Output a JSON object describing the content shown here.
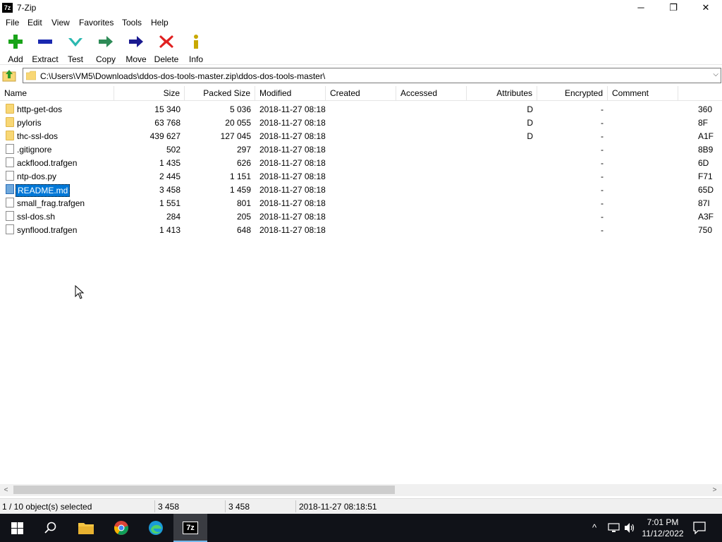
{
  "window": {
    "title": "7-Zip",
    "icon_text": "7z",
    "controls": {
      "minimize": "─",
      "maximize": "❐",
      "close": "✕"
    }
  },
  "menu": [
    "File",
    "Edit",
    "View",
    "Favorites",
    "Tools",
    "Help"
  ],
  "toolbar": {
    "add": "Add",
    "extract": "Extract",
    "test": "Test",
    "copy": "Copy",
    "move": "Move",
    "delete": "Delete",
    "info": "Info"
  },
  "address": {
    "path": "C:\\Users\\VM5\\Downloads\\ddos-dos-tools-master.zip\\ddos-dos-tools-master\\",
    "dropdown_glyph": "⌵"
  },
  "columns": [
    "Name",
    "Size",
    "Packed Size",
    "Modified",
    "Created",
    "Accessed",
    "Attributes",
    "Encrypted",
    "Comment"
  ],
  "files": [
    {
      "name": "http-get-dos",
      "type": "folder",
      "size": "15 340",
      "packed": "5 036",
      "modified": "2018-11-27 08:18",
      "attributes": "D",
      "encrypted": "-",
      "crc": "360",
      "selected": false
    },
    {
      "name": "pyloris",
      "type": "folder",
      "size": "63 768",
      "packed": "20 055",
      "modified": "2018-11-27 08:18",
      "attributes": "D",
      "encrypted": "-",
      "crc": "8F",
      "selected": false
    },
    {
      "name": "thc-ssl-dos",
      "type": "folder",
      "size": "439 627",
      "packed": "127 045",
      "modified": "2018-11-27 08:18",
      "attributes": "D",
      "encrypted": "-",
      "crc": "A1F",
      "selected": false
    },
    {
      "name": ".gitignore",
      "type": "file",
      "size": "502",
      "packed": "297",
      "modified": "2018-11-27 08:18",
      "attributes": "",
      "encrypted": "-",
      "crc": "8B9",
      "selected": false
    },
    {
      "name": "ackflood.trafgen",
      "type": "file",
      "size": "1 435",
      "packed": "626",
      "modified": "2018-11-27 08:18",
      "attributes": "",
      "encrypted": "-",
      "crc": "6D",
      "selected": false
    },
    {
      "name": "ntp-dos.py",
      "type": "file",
      "size": "2 445",
      "packed": "1 151",
      "modified": "2018-11-27 08:18",
      "attributes": "",
      "encrypted": "-",
      "crc": "F71",
      "selected": false
    },
    {
      "name": "README.md",
      "type": "file",
      "size": "3 458",
      "packed": "1 459",
      "modified": "2018-11-27 08:18",
      "attributes": "",
      "encrypted": "-",
      "crc": "65D",
      "selected": true
    },
    {
      "name": "small_frag.trafgen",
      "type": "file",
      "size": "1 551",
      "packed": "801",
      "modified": "2018-11-27 08:18",
      "attributes": "",
      "encrypted": "-",
      "crc": "87I",
      "selected": false
    },
    {
      "name": "ssl-dos.sh",
      "type": "file",
      "size": "284",
      "packed": "205",
      "modified": "2018-11-27 08:18",
      "attributes": "",
      "encrypted": "-",
      "crc": "A3F",
      "selected": false
    },
    {
      "name": "synflood.trafgen",
      "type": "file",
      "size": "1 413",
      "packed": "648",
      "modified": "2018-11-27 08:18",
      "attributes": "",
      "encrypted": "-",
      "crc": "750",
      "selected": false
    }
  ],
  "status": {
    "selection": "1 / 10 object(s) selected",
    "size": "3 458",
    "packed": "3 458",
    "modified": "2018-11-27 08:18:51"
  },
  "scroll": {
    "left_arrow": "<",
    "right_arrow": ">"
  },
  "taskbar": {
    "time": "7:01 PM",
    "date": "11/12/2022",
    "active_app": "7-Zip",
    "tray_chevron": "^"
  },
  "colors": {
    "selection": "#0078d7",
    "taskbar": "#101218",
    "add_green": "#19a319",
    "delete_red": "#e02020"
  }
}
